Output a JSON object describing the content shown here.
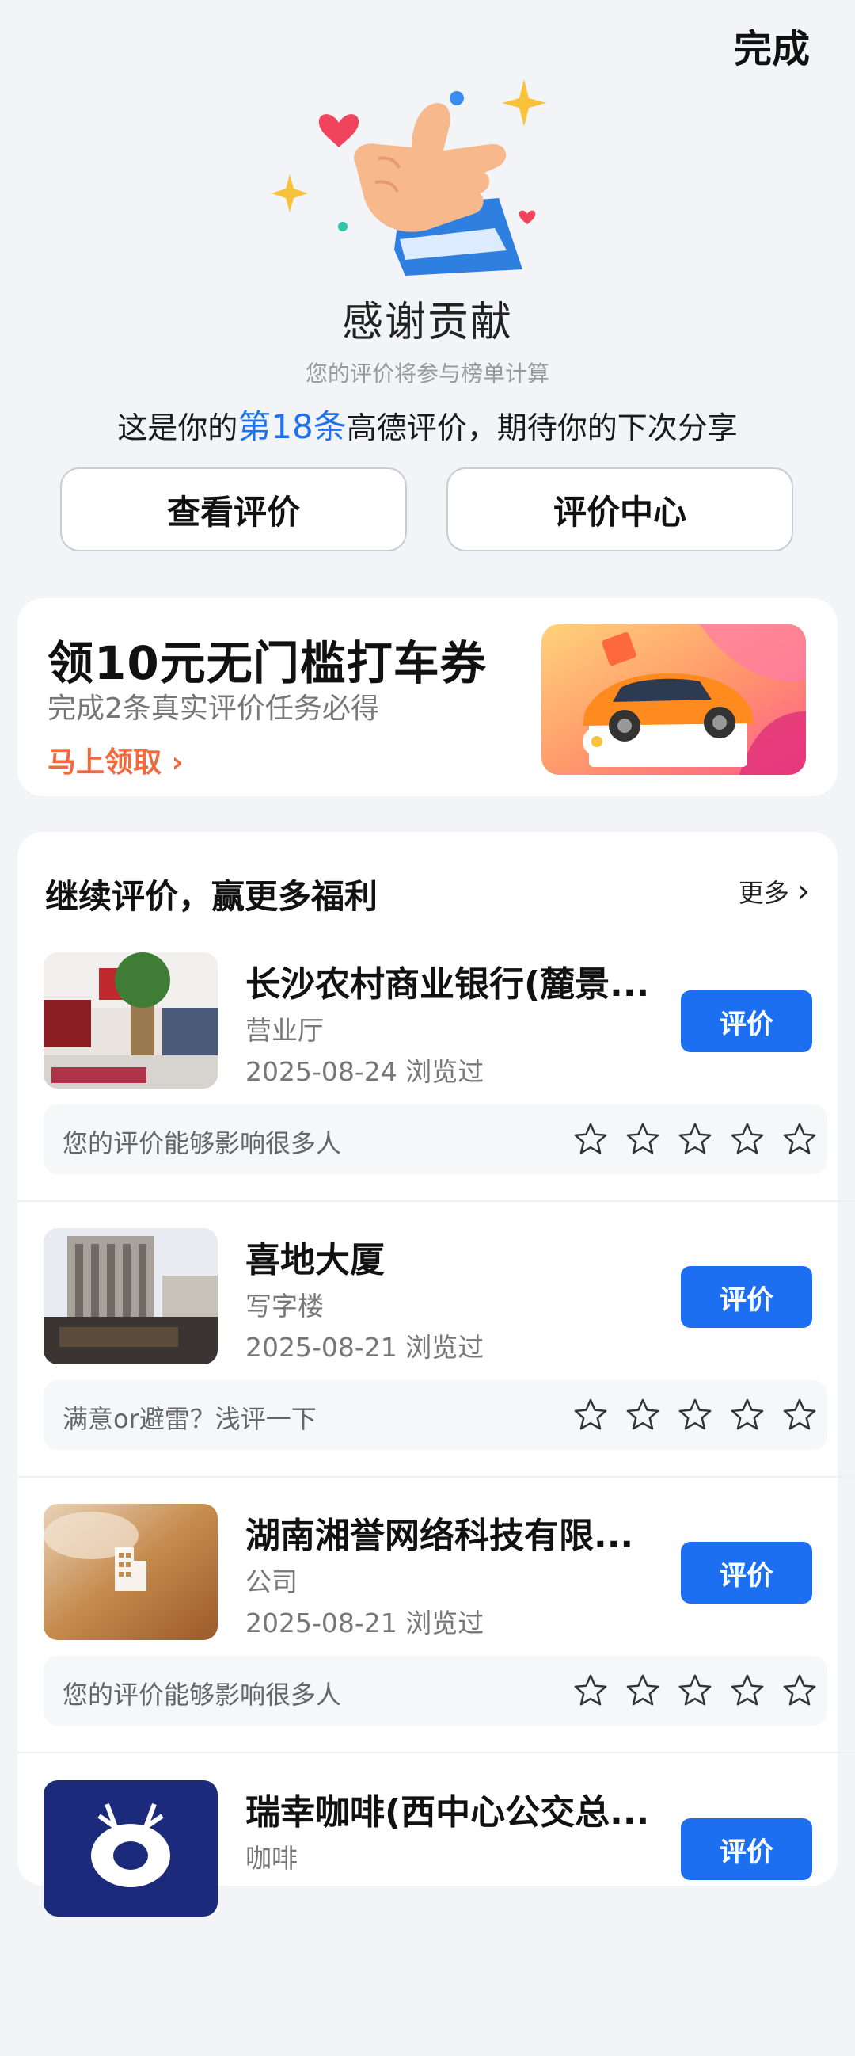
{
  "header": {
    "done_label": "完成"
  },
  "result": {
    "title": "感谢贡献",
    "subtitle": "您的评价将参与榜单计算",
    "thanks_prefix": "这是你的",
    "thanks_highlight": "第18条",
    "thanks_suffix": "高德评价，期待你的下次分享",
    "view_button": "查看评价",
    "center_button": "评价中心"
  },
  "promo": {
    "title": "领10元无门槛打车券",
    "subtitle": "完成2条真实评价任务必得",
    "link": "马上领取"
  },
  "continue_section": {
    "title": "继续评价，赢更多福利",
    "more_label": "更多",
    "items": [
      {
        "name": "长沙农村商业银行(麓景...",
        "category": "营业厅",
        "date": "2025-08-24 浏览过",
        "button": "评价",
        "hint": "您的评价能够影响很多人"
      },
      {
        "name": "喜地大厦",
        "category": "写字楼",
        "date": "2025-08-21 浏览过",
        "button": "评价",
        "hint": "满意or避雷？浅评一下"
      },
      {
        "name": "湖南湘誉网络科技有限...",
        "category": "公司",
        "date": "2025-08-21 浏览过",
        "button": "评价",
        "hint": "您的评价能够影响很多人"
      },
      {
        "name": "瑞幸咖啡(西中心公交总...",
        "category": "咖啡",
        "date": "",
        "button": "评价",
        "hint": ""
      }
    ]
  },
  "colors": {
    "accent": "#1d6ff2",
    "promo_link": "#f06a3d"
  }
}
